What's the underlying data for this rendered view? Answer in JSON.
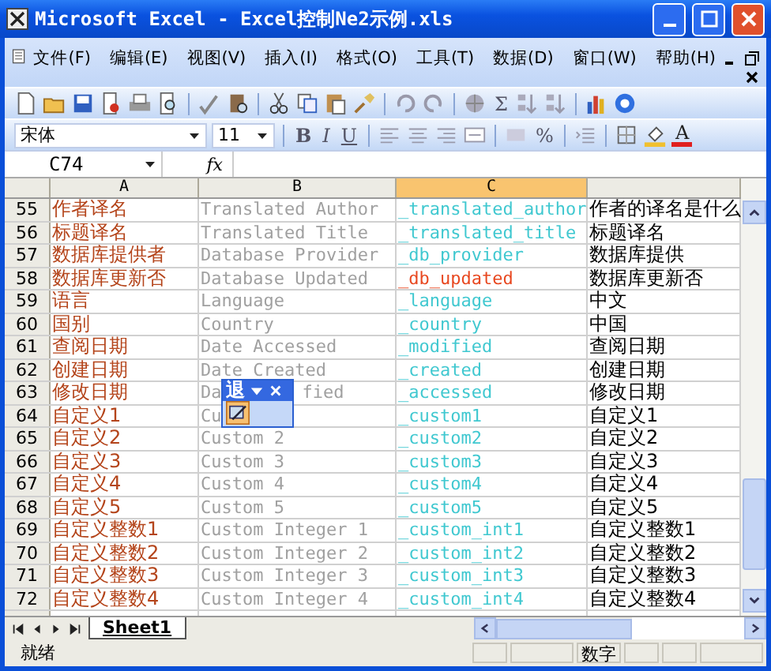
{
  "window": {
    "title": "Microsoft Excel - Excel控制Ne2示例.xls"
  },
  "menu": [
    "文件(F)",
    "编辑(E)",
    "视图(V)",
    "插入(I)",
    "格式(O)",
    "工具(T)",
    "数据(D)",
    "窗口(W)",
    "帮助(H)"
  ],
  "standard_toolbar": {
    "sum": "Σ"
  },
  "format_toolbar": {
    "font": "宋体",
    "size": "11",
    "bold": "B",
    "italic": "I",
    "underline": "U",
    "percent": "%",
    "font_color": "A"
  },
  "formula_bar": {
    "name_box": "C74",
    "fx": "fx"
  },
  "columns": [
    {
      "label": "A",
      "selected": false
    },
    {
      "label": "B",
      "selected": false
    },
    {
      "label": "C",
      "selected": true
    },
    {
      "selected": false
    }
  ],
  "rows": [
    {
      "n": "55",
      "a": "作者译名",
      "b": "Translated Author",
      "c": "_translated_author",
      "color": "#40c8d0",
      "d": "作者的译名是什么"
    },
    {
      "n": "56",
      "a": "标题译名",
      "b": "Translated Title",
      "c": "_translated_title",
      "color": "#40c8d0",
      "d": "标题译名"
    },
    {
      "n": "57",
      "a": "数据库提供者",
      "b": "Database Provider",
      "c": "_db_provider",
      "color": "#40c8d0",
      "d": "数据库提供"
    },
    {
      "n": "58",
      "a": "数据库更新否",
      "b": "Database Updated",
      "c": "_db_updated",
      "color": "#e84820",
      "d": "数据库更新否"
    },
    {
      "n": "59",
      "a": "语言",
      "b": "Language",
      "c": "_language",
      "color": "#40c8d0",
      "d": "中文"
    },
    {
      "n": "60",
      "a": "国别",
      "b": "Country",
      "c": "_country",
      "color": "#40c8d0",
      "d": "中国"
    },
    {
      "n": "61",
      "a": "查阅日期",
      "b": "Date Accessed",
      "c": "_modified",
      "color": "#40c8d0",
      "d": "查阅日期"
    },
    {
      "n": "62",
      "a": "创建日期",
      "b": "Date Created",
      "c": "_created",
      "color": "#40c8d0",
      "d": "创建日期"
    },
    {
      "n": "63",
      "a": "修改日期",
      "b": "Da",
      "b_tail": "fied",
      "c": "_accessed",
      "color": "#40c8d0",
      "d": "修改日期"
    },
    {
      "n": "64",
      "a": "自定义1",
      "b": "Cu",
      "c": "_custom1",
      "color": "#40c8d0",
      "d": "自定义1"
    },
    {
      "n": "65",
      "a": "自定义2",
      "b": "Custom 2",
      "c": "_custom2",
      "color": "#40c8d0",
      "d": "自定义2"
    },
    {
      "n": "66",
      "a": "自定义3",
      "b": "Custom 3",
      "c": "_custom3",
      "color": "#40c8d0",
      "d": "自定义3"
    },
    {
      "n": "67",
      "a": "自定义4",
      "b": "Custom 4",
      "c": "_custom4",
      "color": "#40c8d0",
      "d": "自定义4"
    },
    {
      "n": "68",
      "a": "自定义5",
      "b": "Custom 5",
      "c": "_custom5",
      "color": "#40c8d0",
      "d": "自定义5"
    },
    {
      "n": "69",
      "a": "自定义整数1",
      "b": "Custom Integer 1",
      "c": "_custom_int1",
      "color": "#40c8d0",
      "d": "自定义整数1"
    },
    {
      "n": "70",
      "a": "自定义整数2",
      "b": "Custom Integer 2",
      "c": "_custom_int2",
      "color": "#40c8d0",
      "d": "自定义整数2"
    },
    {
      "n": "71",
      "a": "自定义整数3",
      "b": "Custom Integer 3",
      "c": "_custom_int3",
      "color": "#40c8d0",
      "d": "自定义整数3"
    },
    {
      "n": "72",
      "a": "自定义整数4",
      "b": "Custom Integer 4",
      "c": "_custom_int4",
      "color": "#40c8d0",
      "d": "自定义整数4"
    }
  ],
  "floating_toolbar": {
    "title": "退"
  },
  "sheet_tabs": [
    {
      "label": "Sheet1",
      "selected": true
    }
  ],
  "status_bar": {
    "status": "就绪",
    "mode": "数字"
  }
}
